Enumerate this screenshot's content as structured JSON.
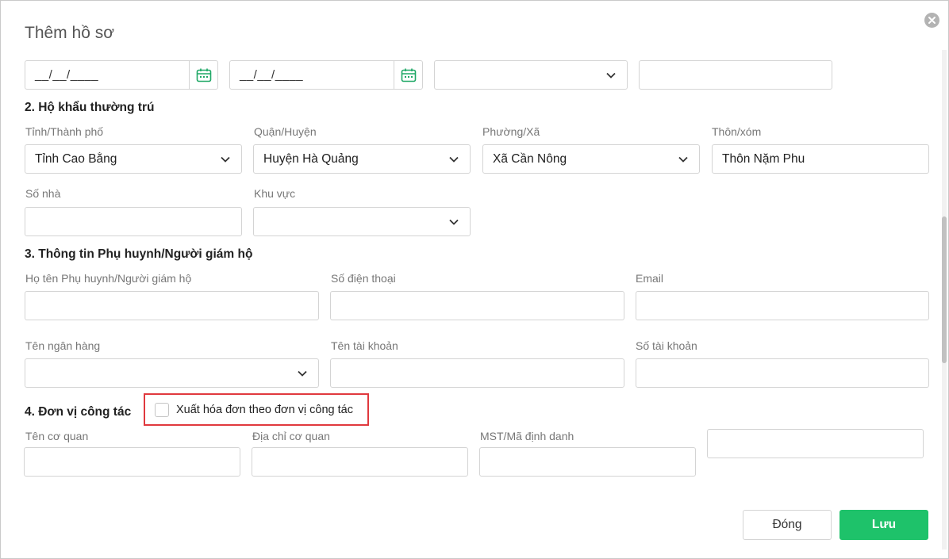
{
  "dialog": {
    "title": "Thêm hồ sơ"
  },
  "top_row": {
    "date1_placeholder": "__/__/____",
    "date2_placeholder": "__/__/____",
    "select_value": "",
    "text_value": ""
  },
  "section2": {
    "heading": "2. Hộ khẩu thường trú",
    "province_label": "Tỉnh/Thành phố",
    "province_value": "Tỉnh Cao Bằng",
    "district_label": "Quận/Huyện",
    "district_value": "Huyện Hà Quảng",
    "ward_label": "Phường/Xã",
    "ward_value": "Xã Cần Nông",
    "hamlet_label": "Thôn/xóm",
    "hamlet_value": "Thôn Nặm Phu",
    "house_no_label": "Số nhà",
    "house_no_value": "",
    "area_label": "Khu vực",
    "area_value": ""
  },
  "section3": {
    "heading": "3. Thông tin Phụ huynh/Người giám hộ",
    "guardian_name_label": "Họ tên Phụ huynh/Người giám hộ",
    "phone_label": "Số điện thoại",
    "email_label": "Email",
    "bank_name_label": "Tên ngân hàng",
    "account_name_label": "Tên tài khoản",
    "account_no_label": "Số tài khoản"
  },
  "section4": {
    "heading": "4. Đơn vị công tác",
    "checkbox_label": "Xuất hóa đơn theo đơn vị công tác",
    "checkbox_checked": false,
    "org_name_label": "Tên cơ quan",
    "org_address_label": "Địa chỉ cơ quan",
    "tax_id_label": "MST/Mã định danh"
  },
  "footer": {
    "close_label": "Đóng",
    "save_label": "Lưu"
  },
  "colors": {
    "accent_green": "#1ec26a",
    "highlight_red": "#e0393e",
    "calendar_icon": "#1fa866"
  },
  "icons": [
    "close-icon",
    "calendar-icon",
    "chevron-down-icon"
  ]
}
